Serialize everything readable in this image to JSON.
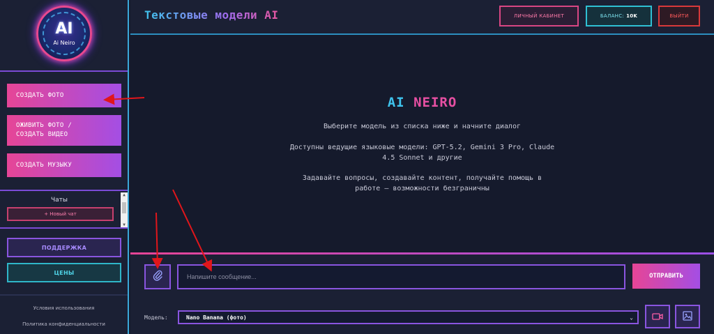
{
  "sidebar": {
    "logo": {
      "text": "AI",
      "subtitle": "Ai Neiro"
    },
    "create_photo": "СОЗДАТЬ ФОТО",
    "animate_photo_line1": "ОЖИВИТЬ ФОТО /",
    "animate_photo_line2": "СОЗДАТЬ ВИДЕО",
    "create_music": "СОЗДАТЬ МУЗЫКУ",
    "chats_title": "Чаты",
    "new_chat": "+ Новый чат",
    "support": "ПОДДЕРЖКА",
    "prices": "ЦЕНЫ",
    "terms": "Условия использования",
    "privacy": "Политика конфиденциальности"
  },
  "header": {
    "title": "Текстовые модели AI",
    "cabinet": "ЛИЧНЫЙ КАБИНЕТ",
    "balance_label": "БАЛАНС:",
    "balance_value": "10K",
    "logout": "ВЫЙТИ"
  },
  "main": {
    "brand_a": "AI ",
    "brand_b": "NEIRO",
    "line1": "Выберите модель из списка ниже и начните диалог",
    "line2a": "Доступны ведущие языковые модели: GPT-5.2, Gemini 3 Pro, Claude",
    "line2b": "4.5 Sonnet и другие",
    "line3a": "Задавайте вопросы, создавайте контент, получайте помощь в",
    "line3b": "работе — возможности безграничны"
  },
  "composer": {
    "placeholder": "Напишите сообщение...",
    "send": "ОТПРАВИТЬ",
    "model_label": "Модель:",
    "model_value": "Nano Banana (фото)"
  },
  "icons": {
    "attach": "paperclip-icon",
    "video": "video-camera-icon",
    "image": "image-icon"
  },
  "colors": {
    "accent_pink": "#e64596",
    "accent_purple": "#a44ee4",
    "accent_cyan": "#3fc4ee",
    "annotation_red": "#e0161b"
  }
}
